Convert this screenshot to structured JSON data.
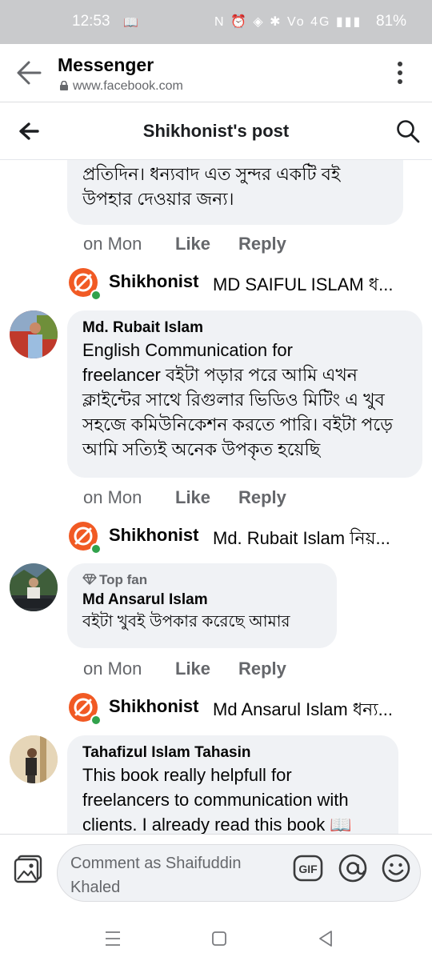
{
  "status_bar": {
    "time": "12:53",
    "battery": "81%",
    "icons": [
      "book-icon",
      "nfc-icon",
      "alarm-icon",
      "vibrate-icon",
      "bluetooth-icon",
      "volte-icon",
      "4g-signal-icon",
      "signal-icon",
      "battery-icon"
    ]
  },
  "browser": {
    "title": "Messenger",
    "url": "www.facebook.com"
  },
  "post_header": {
    "title": "Shikhonist's post"
  },
  "comments": [
    {
      "author": "",
      "text_line1": "প্রতিদিন। ধন্যবাদ এত সুন্দর একটি বই",
      "text_line2": "উপহার দেওয়ার জন্য।",
      "time": "on Mon",
      "like": "Like",
      "reply": "Reply",
      "page_reply_name": "Shikhonist",
      "page_reply_preview": "MD SAIFUL ISLAM ধ..."
    },
    {
      "author": "Md. Rubait Islam",
      "text_line1": "English Communication for",
      "text_line2": "freelancer বইটা পড়ার পরে আমি এখন",
      "text_line3": "ক্লাইন্টের সাথে রিগুলার ভিডিও মিটিং এ খুব",
      "text_line4": "সহজে কমিউনিকেশন করতে পারি। বইটা পড়ে",
      "text_line5": "আমি সত্যিই অনেক উপকৃত হয়েছি",
      "time": "on Mon",
      "like": "Like",
      "reply": "Reply",
      "page_reply_name": "Shikhonist",
      "page_reply_preview": "Md. Rubait Islam নিয়..."
    },
    {
      "badge": "Top fan",
      "author": "Md Ansarul Islam",
      "text_line1": "বইটা খুবই উপকার করেছে আমার",
      "time": "on Mon",
      "like": "Like",
      "reply": "Reply",
      "page_reply_name": "Shikhonist",
      "page_reply_preview": "Md Ansarul Islam ধন্য..."
    },
    {
      "author": "Tahafizul Islam Tahasin",
      "text_line1": "This book really helpfull for",
      "text_line2": "freelancers to communication with",
      "text_line3": "clients. I already read this book 📖"
    }
  ],
  "composer": {
    "placeholder": "Comment as Shaifuddin Khaled",
    "gif_label": "GIF"
  },
  "colors": {
    "bubble_bg": "#f0f2f5",
    "secondary_text": "#65676b",
    "page_logo": "#f15a24",
    "online_dot": "#31a24c",
    "status_bar": "#c9cacc"
  }
}
